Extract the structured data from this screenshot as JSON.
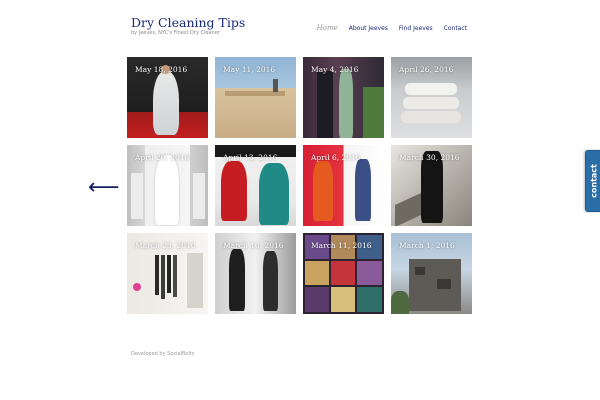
{
  "header": {
    "title": "Dry Cleaning Tips",
    "tagline": "by Jeeves, NYC's Finest Dry Cleaner"
  },
  "nav": {
    "home": "Home",
    "about": "About Jeeves",
    "find": "Find Jeeves",
    "contact": "Contact"
  },
  "posts": [
    {
      "date": "May 18, 2016"
    },
    {
      "date": "May 11, 2016"
    },
    {
      "date": "May 4, 2016"
    },
    {
      "date": "April 26, 2016"
    },
    {
      "date": "April 20, 2016"
    },
    {
      "date": "April 13, 2016"
    },
    {
      "date": "April 6, 2016"
    },
    {
      "date": "March 30, 2016"
    },
    {
      "date": "March 23, 2016"
    },
    {
      "date": "March 16, 2016"
    },
    {
      "date": "March 11, 2016"
    },
    {
      "date": "March 1, 2016"
    }
  ],
  "pager": {
    "prev_icon": "left-arrow-icon",
    "prev_glyph": "⟵"
  },
  "contact_tab": {
    "label": "contact",
    "color": "#2a6ea8"
  },
  "footer": {
    "credit": "Developed by SocialBolts"
  },
  "colors": {
    "title": "#1a2a7a",
    "nav": "#1a2a7a",
    "arrow": "#15206b"
  }
}
